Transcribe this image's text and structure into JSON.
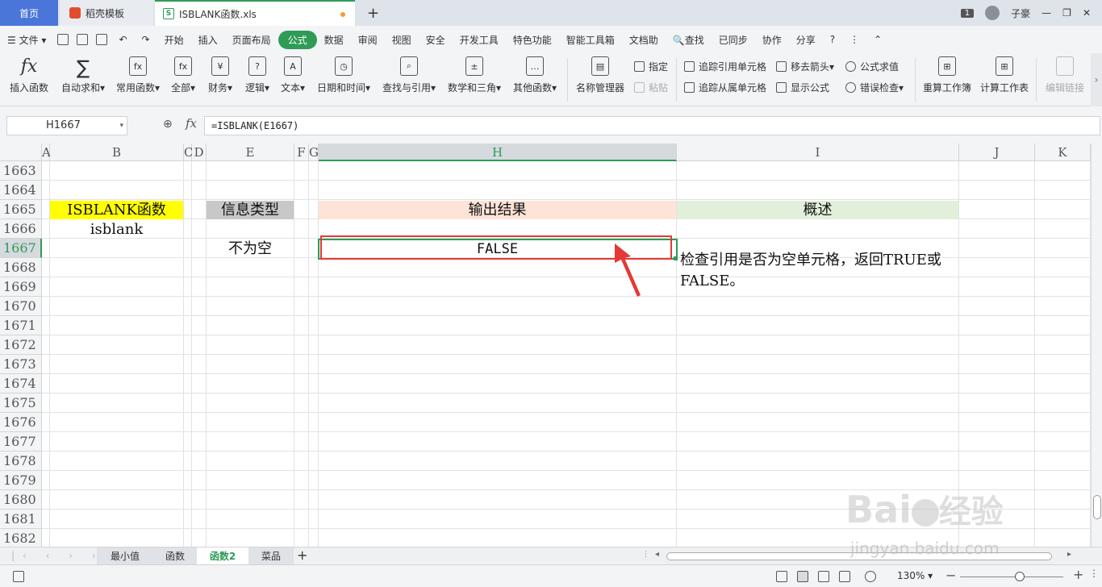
{
  "tabs": {
    "home": "首页",
    "template": "稻壳模板",
    "file": "ISBLANK函数.xls"
  },
  "window": {
    "badge": "1",
    "user": "子豪"
  },
  "menu": {
    "file": "文件",
    "items": [
      "开始",
      "插入",
      "页面布局",
      "公式",
      "数据",
      "审阅",
      "视图",
      "安全",
      "开发工具",
      "特色功能",
      "智能工具箱",
      "文档助"
    ],
    "active": "公式",
    "search": "查找",
    "sync": "已同步",
    "collab": "协作",
    "share": "分享"
  },
  "ribbon": {
    "insert_fn": "插入函数",
    "autosum": "自动求和",
    "common_fn": "常用函数",
    "all": "全部",
    "finance": "财务",
    "logic": "逻辑",
    "text": "文本",
    "datetime": "日期和时间",
    "lookup": "查找与引用",
    "math": "数学和三角",
    "other_fn": "其他函数",
    "name_mgr": "名称管理器",
    "specify": "指定",
    "paste": "粘贴",
    "trace_prec": "追踪引用单元格",
    "trace_dep": "追踪从属单元格",
    "remove_arrows": "移去箭头",
    "show_formula": "显示公式",
    "eval_formula": "公式求值",
    "error_check": "错误检查",
    "recalc_wb": "重算工作簿",
    "calc_sheet": "计算工作表",
    "edit_links": "编辑链接"
  },
  "formula_bar": {
    "name_box": "H1667",
    "fx": "fx",
    "formula": "=ISBLANK(E1667)"
  },
  "columns": [
    "A",
    "B",
    "C",
    "D",
    "E",
    "F",
    "G",
    "H",
    "I",
    "J",
    "K"
  ],
  "rows": [
    "1663",
    "1664",
    "1665",
    "1666",
    "1667",
    "1668",
    "1669",
    "1670",
    "1671",
    "1672",
    "1673",
    "1674",
    "1675",
    "1676",
    "1677",
    "1678",
    "1679",
    "1680",
    "1681",
    "1682"
  ],
  "cells": {
    "b1665": "ISBLANK函数",
    "b1666": "isblank",
    "e1665": "信息类型",
    "e1667": "不为空",
    "h1665": "输出结果",
    "h1667": "FALSE",
    "i1665": "概述",
    "i1667": "检查引用是否为空单元格，返回TRUE或FALSE。"
  },
  "sheets": [
    "最小值",
    "函数",
    "函数2",
    "菜品"
  ],
  "active_sheet": "函数2",
  "status": {
    "zoom": "130%"
  },
  "colors": {
    "accent": "#2f9b57",
    "header_yellow": "#ffff00",
    "header_gray": "#c8c8c8",
    "header_peach": "#fde4d6",
    "header_green": "#e2efda",
    "arrow_red": "#e53935"
  },
  "watermark": {
    "brand": "Bai",
    "suffix": "经验",
    "url": "jingyan.baidu.com"
  }
}
